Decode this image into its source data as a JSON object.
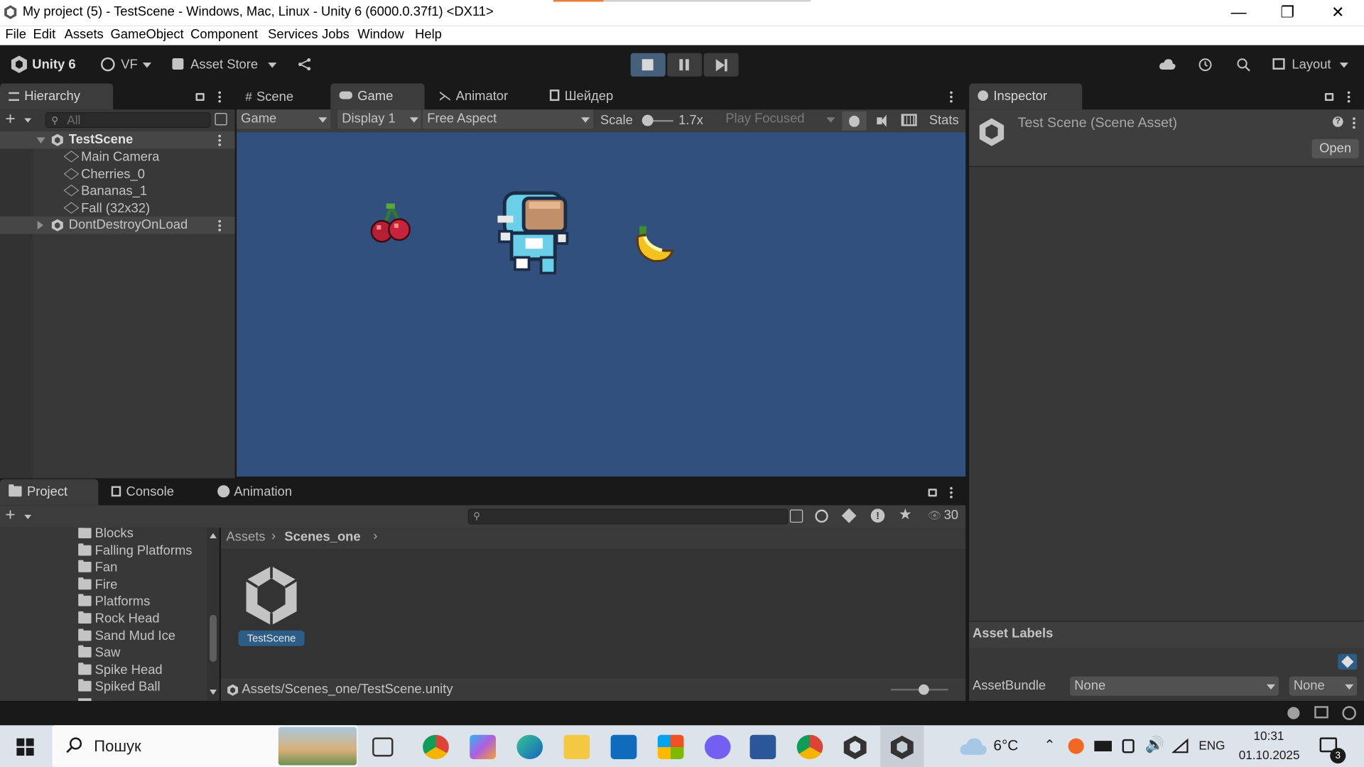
{
  "window": {
    "title": "My project (5) - TestScene - Windows, Mac, Linux - Unity 6 (6000.0.37f1) <DX11>"
  },
  "menu": [
    "File",
    "Edit",
    "Assets",
    "GameObject",
    "Component",
    "Services",
    "Jobs",
    "Window",
    "Help"
  ],
  "toolbar": {
    "unity_label": "Unity 6",
    "account": "VF",
    "asset_store": "Asset Store",
    "layout": "Layout"
  },
  "hierarchy": {
    "tab": "Hierarchy",
    "search_placeholder": "All",
    "scene": "TestScene",
    "items": [
      "Main Camera",
      "Cherries_0",
      "Bananas_1",
      "Fall (32x32)"
    ],
    "dont_destroy": "DontDestroyOnLoad"
  },
  "center_tabs": [
    "Scene",
    "Game",
    "Animator",
    "Шейдер"
  ],
  "game_toolbar": {
    "mode": "Game",
    "display": "Display 1",
    "aspect": "Free Aspect",
    "scale_label": "Scale",
    "scale_value": "1.7x",
    "play_focused": "Play Focused",
    "stats": "Stats"
  },
  "inspector": {
    "tab": "Inspector",
    "title": "Test Scene (Scene Asset)",
    "open": "Open",
    "asset_labels": "Asset Labels",
    "assetbundle_label": "AssetBundle",
    "assetbundle_value": "None",
    "variant_value": "None"
  },
  "bottom_tabs": [
    "Project",
    "Console",
    "Animation"
  ],
  "project": {
    "folders": [
      "Blocks",
      "Falling Platforms",
      "Fan",
      "Fire",
      "Platforms",
      "Rock Head",
      "Sand Mud Ice",
      "Saw",
      "Spike Head",
      "Spiked Ball"
    ],
    "breadcrumb_root": "Assets",
    "breadcrumb_current": "Scenes_one",
    "asset_name": "TestScene",
    "path": "Assets/Scenes_one/TestScene.unity",
    "count": "30"
  },
  "taskbar": {
    "search": "Пошук",
    "weather": "6°C",
    "lang": "ENG",
    "time": "10:31",
    "date": "01.10.2025",
    "notif": "3"
  },
  "colors": {
    "game_bg": "#31507e",
    "accent": "#2c5d87"
  }
}
